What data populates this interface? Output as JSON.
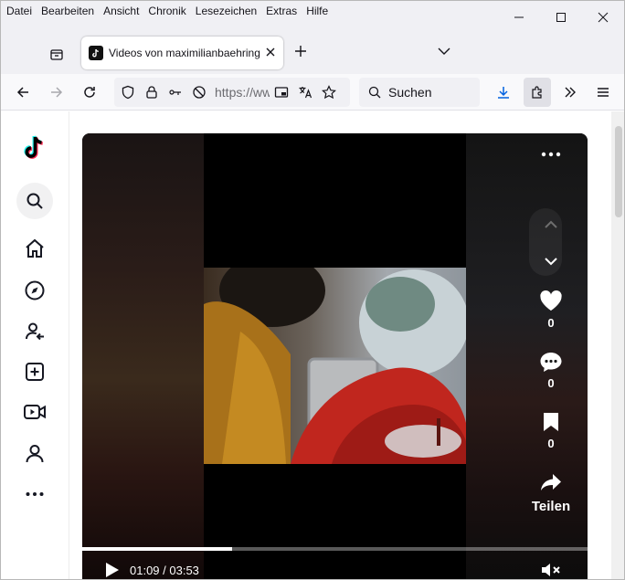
{
  "menu": [
    "Datei",
    "Bearbeiten",
    "Ansicht",
    "Chronik",
    "Lesezeichen",
    "Extras",
    "Hilfe"
  ],
  "tab": {
    "title": "Videos von maximilianbaehring"
  },
  "urlbar": {
    "url": "https://ww"
  },
  "search": {
    "placeholder": "Suchen"
  },
  "sidebar": [
    "tiktok-logo",
    "search-icon",
    "home-icon",
    "explore-icon",
    "following-icon",
    "upload-icon",
    "live-icon",
    "profile-icon",
    "more-icon"
  ],
  "video": {
    "likes": "0",
    "comments": "0",
    "saves": "0",
    "share_label": "Teilen",
    "time": "01:09 / 03:53",
    "progress": 0.296
  }
}
